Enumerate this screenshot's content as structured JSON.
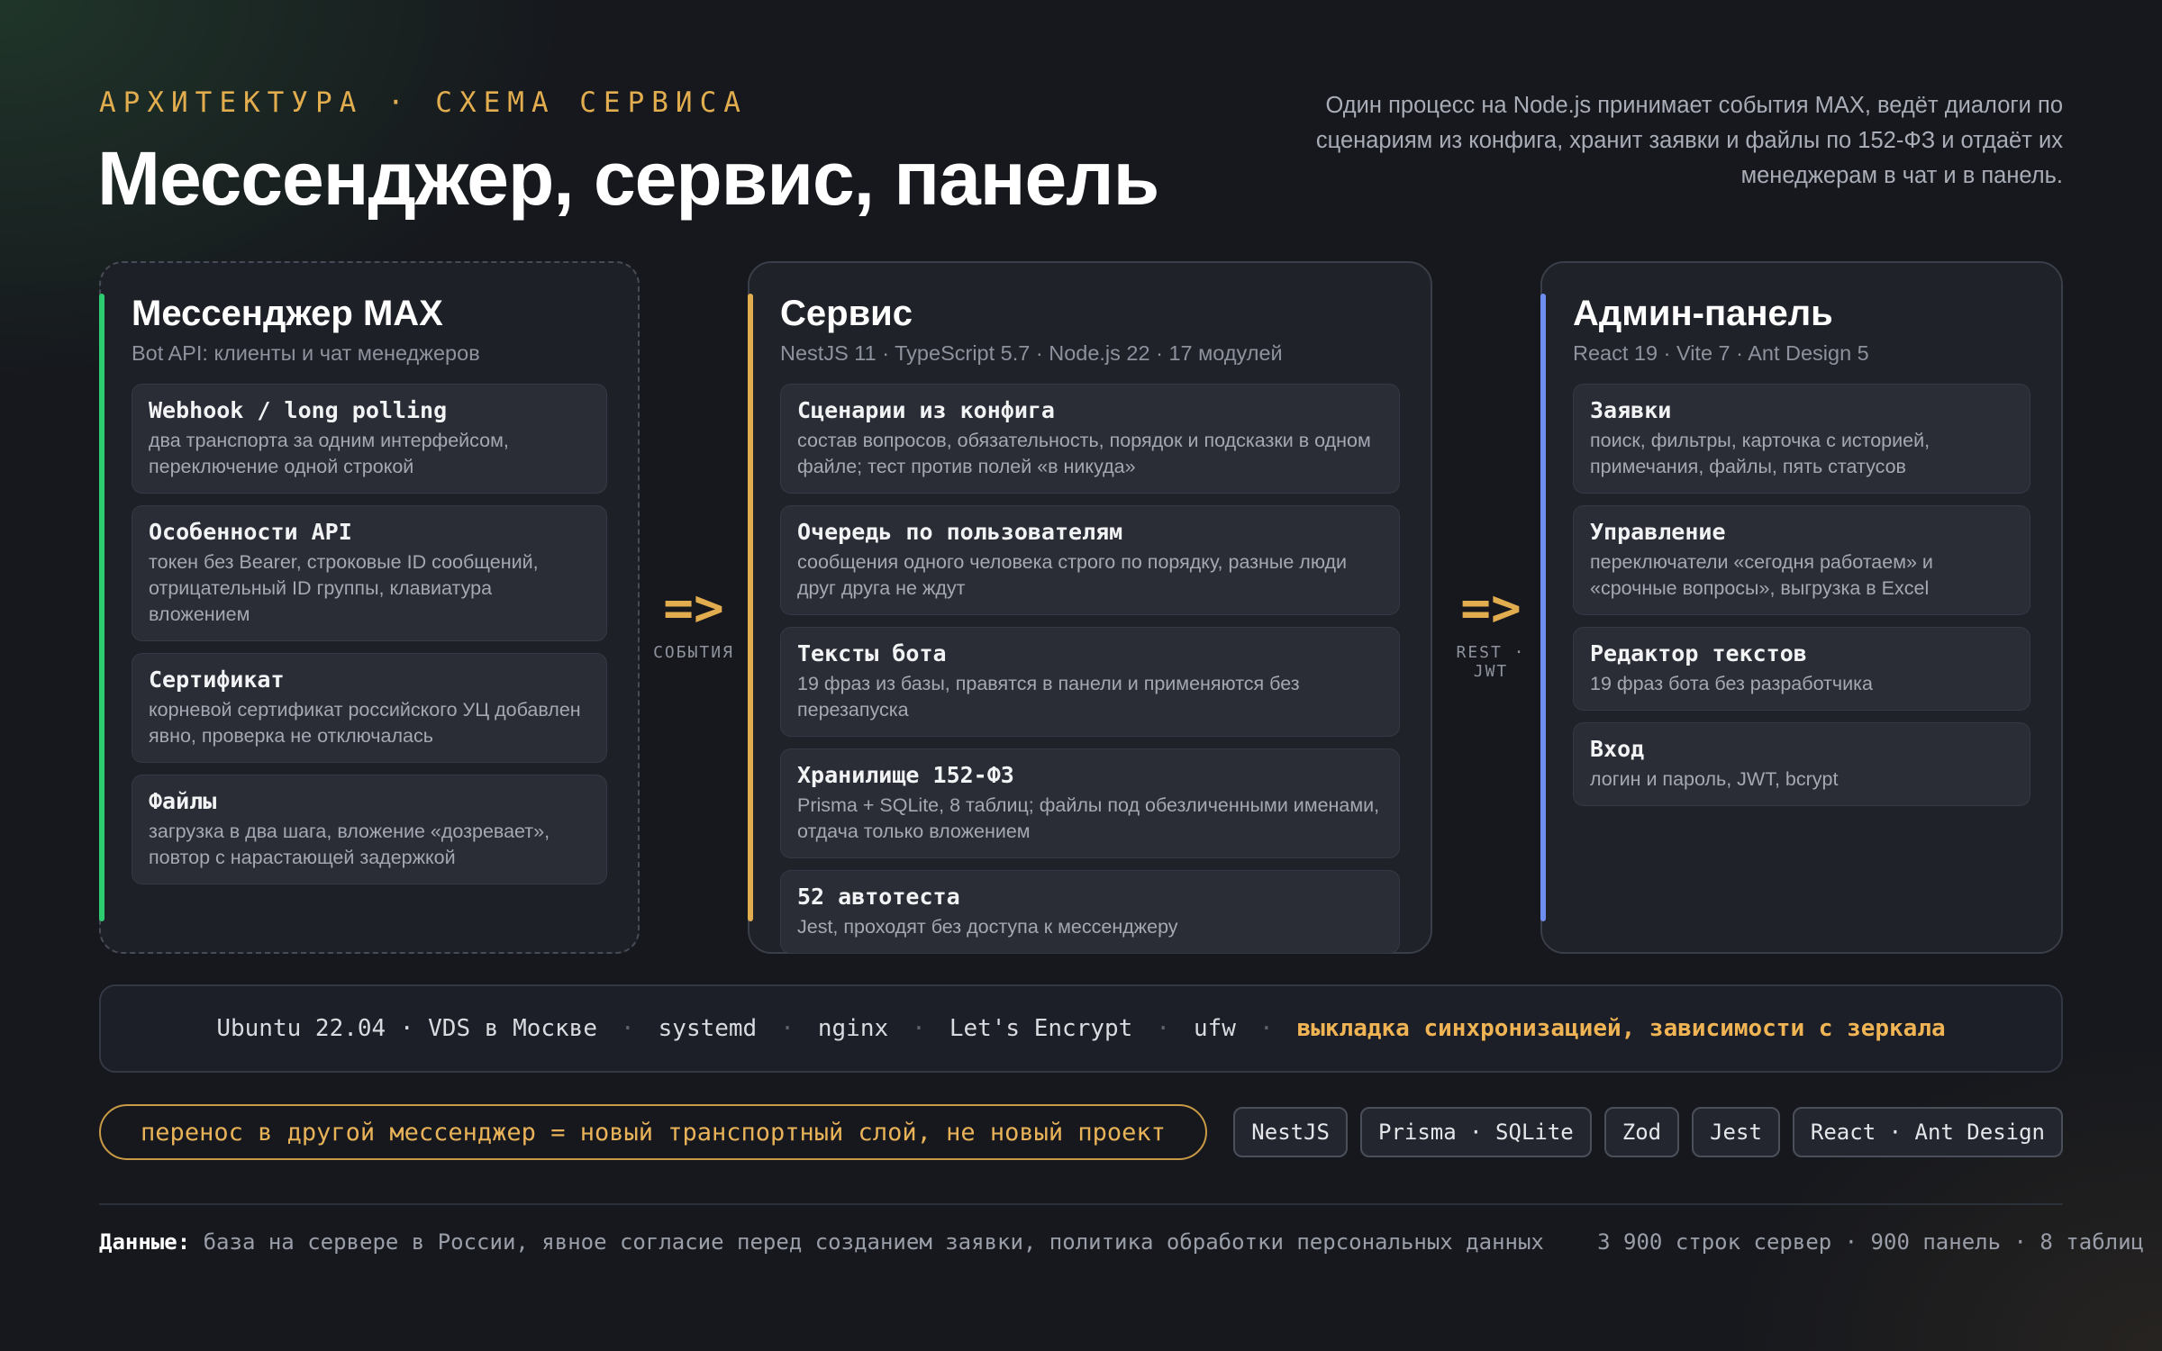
{
  "header": {
    "eyebrow": "АРХИТЕКТУРА · СХЕМА СЕРВИСА",
    "title": "Мессенджер, сервис, панель",
    "intro": "Один процесс на Node.js принимает события MAX, ведёт диалоги по сценариям из конфига, хранит заявки и файлы по 152-ФЗ и отдаёт их менеджерам в чат и в панель."
  },
  "colors": {
    "messenger_accent": "#2ecc71",
    "service_accent": "#e2ad4e",
    "admin_accent": "#6f8ff0",
    "highlight": "#f0b454"
  },
  "panels": {
    "messenger": {
      "title": "Мессенджер MAX",
      "subtitle": "Bot API: клиенты и чат менеджеров",
      "items": [
        {
          "title": "Webhook / long polling",
          "desc": "два транспорта за одним интерфейсом, переключение одной строкой"
        },
        {
          "title": "Особенности API",
          "desc": "токен без Bearer, строковые ID сообщений, отрицательный ID группы, клавиатура вложением"
        },
        {
          "title": "Сертификат",
          "desc": "корневой сертификат российского УЦ добавлен явно, проверка не отключалась"
        },
        {
          "title": "Файлы",
          "desc": "загрузка в два шага, вложение «дозревает», повтор с нарастающей задержкой"
        }
      ]
    },
    "service": {
      "title": "Сервис",
      "subtitle": "NestJS 11 · TypeScript 5.7 · Node.js 22 · 17 модулей",
      "items": [
        {
          "title": "Сценарии из конфига",
          "desc": "состав вопросов, обязательность, порядок и подсказки в одном файле; тест против полей «в никуда»"
        },
        {
          "title": "Очередь по пользователям",
          "desc": "сообщения одного человека строго по порядку, разные люди друг друга не ждут"
        },
        {
          "title": "Тексты бота",
          "desc": "19 фраз из базы, правятся в панели и применяются без перезапуска"
        },
        {
          "title": "Хранилище 152‑ФЗ",
          "desc": "Prisma + SQLite, 8 таблиц; файлы под обезличенными именами, отдача только вложением"
        },
        {
          "title": "52 автотеста",
          "desc": "Jest, проходят без доступа к мессенджеру"
        }
      ]
    },
    "admin": {
      "title": "Админ-панель",
      "subtitle": "React 19 · Vite 7 · Ant Design 5",
      "items": [
        {
          "title": "Заявки",
          "desc": "поиск, фильтры, карточка с историей, примечания, файлы, пять статусов"
        },
        {
          "title": "Управление",
          "desc": "переключатели «сегодня работаем» и «срочные вопросы», выгрузка в Excel"
        },
        {
          "title": "Редактор текстов",
          "desc": "19 фраз бота без разработчика"
        },
        {
          "title": "Вход",
          "desc": "логин и пароль, JWT, bcrypt"
        }
      ]
    }
  },
  "arrows": {
    "glyph": "=>",
    "left_label": "СОБЫТИЯ",
    "right_label": "REST · JWT"
  },
  "infra": {
    "items": [
      "Ubuntu 22.04 · VDS в Москве",
      "systemd",
      "nginx",
      "Let's Encrypt",
      "ufw"
    ],
    "separator": "·",
    "highlight": "выкладка синхронизацией, зависимости с зеркала"
  },
  "migration_note": "перенос в другой мессенджер = новый транспортный слой, не новый проект",
  "tags": [
    "NestJS",
    "Prisma · SQLite",
    "Zod",
    "Jest",
    "React · Ant Design"
  ],
  "footer": {
    "label": "Данные:",
    "text": "база на сервере в России, явное согласие перед созданием заявки, политика обработки персональных данных",
    "stats": "3 900 строк сервер · 900 панель · 8 таблиц"
  }
}
